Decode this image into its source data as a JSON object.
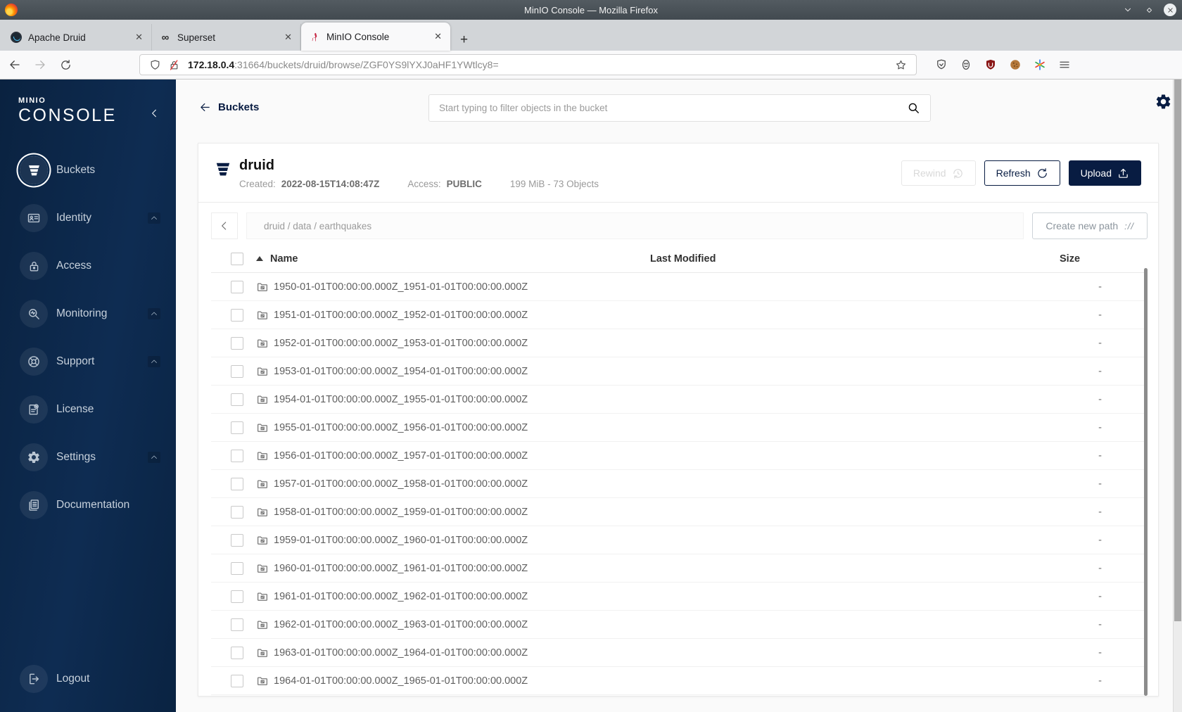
{
  "browser": {
    "window_title": "MinIO Console — Mozilla Firefox",
    "window_controls": [
      "chevron-down-icon",
      "diamond-icon",
      "close-icon"
    ],
    "tabs": [
      {
        "label": "Apache Druid",
        "icon": "druid-favicon",
        "active": false
      },
      {
        "label": "Superset",
        "icon": "superset-favicon",
        "active": false
      },
      {
        "label": "MinIO Console",
        "icon": "minio-favicon",
        "active": true
      }
    ],
    "tab_close_glyph": "✕",
    "new_tab_label": "+",
    "nav_icons": [
      "back-arrow-icon",
      "forward-arrow-icon",
      "reload-icon"
    ],
    "url": {
      "host": "172.18.0.4",
      "rest": ":31664/buckets/druid/browse/ZGF0YS9lYXJ0aHF1YWtlcy8="
    },
    "urlbar_icons_left": [
      "shield-icon",
      "lock-slash-icon"
    ],
    "urlbar_icons_right": [
      "star-icon"
    ],
    "toolbar_icons": [
      "pocket-icon",
      "containers-icon",
      "ublock-icon",
      "cookie-icon",
      "extension-color-icon",
      "menu-icon"
    ]
  },
  "sidebar": {
    "logo_top": "MINIO",
    "logo_bottom": "CONSOLE",
    "items": [
      {
        "label": "Buckets",
        "icon": "bucket-icon",
        "selected": true,
        "expandable": false
      },
      {
        "label": "Identity",
        "icon": "identity-icon",
        "selected": false,
        "expandable": true
      },
      {
        "label": "Access",
        "icon": "access-icon",
        "selected": false,
        "expandable": false
      },
      {
        "label": "Monitoring",
        "icon": "monitoring-icon",
        "selected": false,
        "expandable": true
      },
      {
        "label": "Support",
        "icon": "support-icon",
        "selected": false,
        "expandable": true
      },
      {
        "label": "License",
        "icon": "license-icon",
        "selected": false,
        "expandable": false
      },
      {
        "label": "Settings",
        "icon": "settings-icon",
        "selected": false,
        "expandable": true
      },
      {
        "label": "Documentation",
        "icon": "documentation-icon",
        "selected": false,
        "expandable": false
      }
    ],
    "logout_label": "Logout"
  },
  "header": {
    "back_label": "Buckets",
    "search_placeholder": "Start typing to filter objects in the bucket"
  },
  "bucket": {
    "name": "druid",
    "created_label": "Created:",
    "created": "2022-08-15T14:08:47Z",
    "access_label": "Access:",
    "access": "PUBLIC",
    "summary": "199 MiB - 73 Objects",
    "rewind_label": "Rewind",
    "refresh_label": "Refresh",
    "upload_label": "Upload"
  },
  "browse": {
    "breadcrumb": "druid / data / earthquakes",
    "create_path_label": "Create new path",
    "columns": {
      "name": "Name",
      "last_modified": "Last Modified",
      "size": "Size"
    },
    "objects": [
      {
        "name": "1950-01-01T00:00:00.000Z_1951-01-01T00:00:00.000Z",
        "last_modified": "",
        "size": "-"
      },
      {
        "name": "1951-01-01T00:00:00.000Z_1952-01-01T00:00:00.000Z",
        "last_modified": "",
        "size": "-"
      },
      {
        "name": "1952-01-01T00:00:00.000Z_1953-01-01T00:00:00.000Z",
        "last_modified": "",
        "size": "-"
      },
      {
        "name": "1953-01-01T00:00:00.000Z_1954-01-01T00:00:00.000Z",
        "last_modified": "",
        "size": "-"
      },
      {
        "name": "1954-01-01T00:00:00.000Z_1955-01-01T00:00:00.000Z",
        "last_modified": "",
        "size": "-"
      },
      {
        "name": "1955-01-01T00:00:00.000Z_1956-01-01T00:00:00.000Z",
        "last_modified": "",
        "size": "-"
      },
      {
        "name": "1956-01-01T00:00:00.000Z_1957-01-01T00:00:00.000Z",
        "last_modified": "",
        "size": "-"
      },
      {
        "name": "1957-01-01T00:00:00.000Z_1958-01-01T00:00:00.000Z",
        "last_modified": "",
        "size": "-"
      },
      {
        "name": "1958-01-01T00:00:00.000Z_1959-01-01T00:00:00.000Z",
        "last_modified": "",
        "size": "-"
      },
      {
        "name": "1959-01-01T00:00:00.000Z_1960-01-01T00:00:00.000Z",
        "last_modified": "",
        "size": "-"
      },
      {
        "name": "1960-01-01T00:00:00.000Z_1961-01-01T00:00:00.000Z",
        "last_modified": "",
        "size": "-"
      },
      {
        "name": "1961-01-01T00:00:00.000Z_1962-01-01T00:00:00.000Z",
        "last_modified": "",
        "size": "-"
      },
      {
        "name": "1962-01-01T00:00:00.000Z_1963-01-01T00:00:00.000Z",
        "last_modified": "",
        "size": "-"
      },
      {
        "name": "1963-01-01T00:00:00.000Z_1964-01-01T00:00:00.000Z",
        "last_modified": "",
        "size": "-"
      },
      {
        "name": "1964-01-01T00:00:00.000Z_1965-01-01T00:00:00.000Z",
        "last_modified": "",
        "size": "-"
      }
    ]
  },
  "colors": {
    "brand_navy": "#081C42",
    "sidebar_gradient_start": "#0a2240",
    "sidebar_gradient_mid": "#0e2c52",
    "titlebar": "#4a5257",
    "page_bg": "#fafafa"
  }
}
